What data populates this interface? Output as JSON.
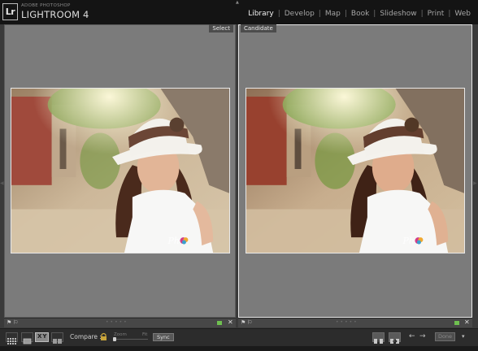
{
  "app": {
    "logo": "Lr",
    "brand_small": "ADOBE PHOTOSHOP",
    "brand_name": "LIGHTROOM 4"
  },
  "modules": [
    {
      "label": "Library",
      "active": true
    },
    {
      "label": "Develop",
      "active": false
    },
    {
      "label": "Map",
      "active": false
    },
    {
      "label": "Book",
      "active": false
    },
    {
      "label": "Slideshow",
      "active": false
    },
    {
      "label": "Print",
      "active": false
    },
    {
      "label": "Web",
      "active": false
    }
  ],
  "panes": {
    "left_label": "Select",
    "right_label": "Candidate"
  },
  "toolbar": {
    "compare_label": "Compare :",
    "zoom_label": "Zoom",
    "fit_label": "Fit",
    "sync_label": "Sync",
    "done_label": "Done",
    "zoom_level": 0,
    "xy_label": "XY"
  },
  "colors": {
    "accent_active_module": "#f2f2f2",
    "pick_flag_green": "#6fc050",
    "pane_bg": "#7b7b7b"
  },
  "icons": [
    "grid-view-icon",
    "loupe-view-icon",
    "compare-view-icon",
    "survey-view-icon",
    "lock-icon",
    "flag-icon",
    "close-icon",
    "swap-icon",
    "make-select-icon",
    "prev-arrow-icon",
    "next-arrow-icon",
    "chevron-down-icon"
  ]
}
